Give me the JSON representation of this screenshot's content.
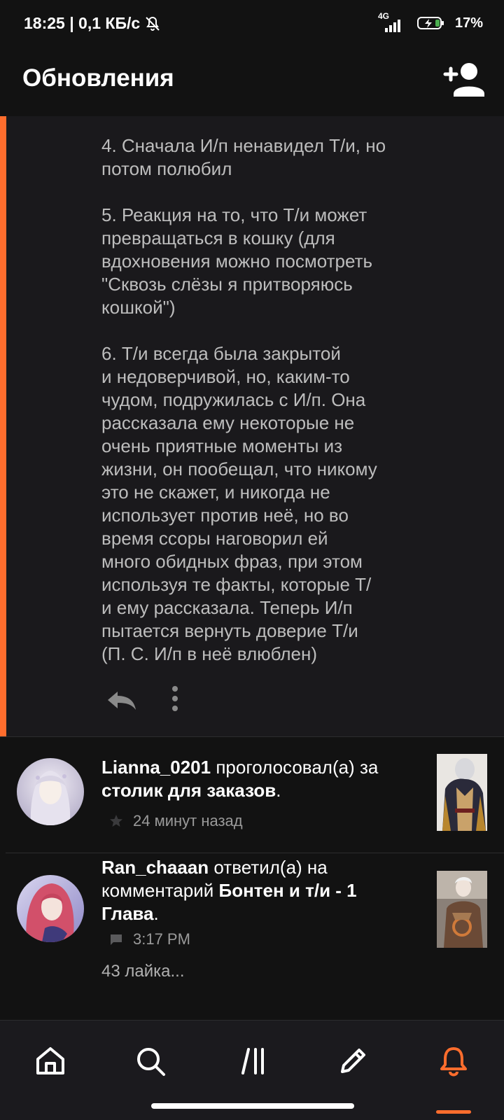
{
  "status_bar": {
    "time_speed": "18:25 | 0,1 КБ/с",
    "network_label": "4G",
    "battery_percent": "17%"
  },
  "app_bar": {
    "title": "Обновления"
  },
  "comment": {
    "text": "4. Сначала И/п ненавидел Т/и, но\nпотом полюбил\n\n5. Реакция на то, что Т/и может\nпревращаться в кошку (для\nвдохновения можно посмотреть\n\"Сквозь слёзы я притворяюсь\nкошкой\")\n\n6. Т/и всегда была закрытой\nи недоверчивой, но, каким-то\nчудом, подружилась с И/п. Она\nрассказала ему некоторые не\nочень приятные моменты из\nжизни, он пообещал, что никому\nэто не скажет, и никогда не\nиспользует против неё, но во\nвремя ссоры наговорил ей\nмного обидных фраз, при этом\nиспользуя те факты, которые Т/\nи ему рассказала. Теперь И/п\nпытается вернуть доверие Т/и\n(П. С. И/п в неё влюблен)"
  },
  "notifications": [
    {
      "user": "Lianna_0201",
      "action": " проголосовал(а) за ",
      "target": "столик для заказов",
      "suffix": ".",
      "time": "24 минут назад",
      "meta_icon": "star-icon"
    },
    {
      "user": "Ran_chaaan",
      "action": " ответил(а) на комментарий ",
      "target": "Бонтен и т/и - 1 Глава",
      "suffix": ".",
      "time": "3:17 PM",
      "meta_icon": "comment-icon",
      "extra": "43 лайка..."
    }
  ],
  "colors": {
    "accent": "#ff6d2d",
    "background": "#121212",
    "card": "#1a191c"
  },
  "bottom_nav": {
    "items": [
      "home-icon",
      "search-icon",
      "library-icon",
      "write-icon",
      "bell-icon"
    ],
    "active": "bell-icon"
  }
}
